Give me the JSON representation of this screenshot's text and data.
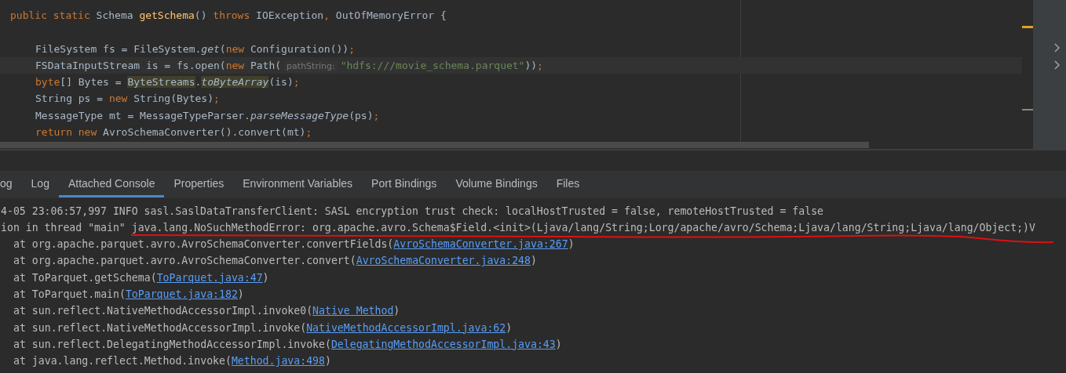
{
  "editor": {
    "lines": [
      {
        "current": false,
        "indented": false,
        "tokens": [
          {
            "kind": "keyword",
            "text": "public static"
          },
          {
            "kind": "plain",
            "text": " Schema "
          },
          {
            "kind": "declaration",
            "text": "getSchema"
          },
          {
            "kind": "plain",
            "text": "() "
          },
          {
            "kind": "keyword",
            "text": "throws"
          },
          {
            "kind": "plain",
            "text": " IOException"
          },
          {
            "kind": "keyword",
            "text": ","
          },
          {
            "kind": "plain",
            "text": " OutOfMemoryError {"
          }
        ]
      },
      {
        "current": false
      },
      {
        "current": false,
        "indented": true,
        "tokens": [
          {
            "kind": "plain",
            "text": "FileSystem fs = FileSystem."
          },
          {
            "kind": "static",
            "text": "get"
          },
          {
            "kind": "plain",
            "text": "("
          },
          {
            "kind": "keyword",
            "text": "new"
          },
          {
            "kind": "plain",
            "text": " Configuration())"
          },
          {
            "kind": "keyword",
            "text": ";"
          }
        ]
      },
      {
        "current": true,
        "indented": true,
        "tokens": [
          {
            "kind": "plain",
            "text": "FSDataInputStream is = fs.open("
          },
          {
            "kind": "keyword",
            "text": "new"
          },
          {
            "kind": "plain",
            "text": " Path("
          },
          {
            "kind": "hint",
            "text": "pathString:"
          },
          {
            "kind": "string",
            "text": "\"hdfs:///movie_schema.parquet\""
          },
          {
            "kind": "plain",
            "text": "))"
          },
          {
            "kind": "keyword",
            "text": ";"
          }
        ]
      },
      {
        "current": false,
        "indented": true,
        "tokens": [
          {
            "kind": "keyword",
            "text": "byte"
          },
          {
            "kind": "plain",
            "text": "[] Bytes = "
          },
          {
            "kind": "usage",
            "text": "ByteStreams"
          },
          {
            "kind": "plain",
            "text": "."
          },
          {
            "kind": "usage_static",
            "text": "toByteArray"
          },
          {
            "kind": "plain",
            "text": "(is)"
          },
          {
            "kind": "keyword",
            "text": ";"
          }
        ]
      },
      {
        "current": false,
        "indented": true,
        "tokens": [
          {
            "kind": "plain",
            "text": "String ps = "
          },
          {
            "kind": "keyword",
            "text": "new"
          },
          {
            "kind": "plain",
            "text": " String(Bytes)"
          },
          {
            "kind": "keyword",
            "text": ";"
          }
        ]
      },
      {
        "current": false,
        "indented": true,
        "tokens": [
          {
            "kind": "plain",
            "text": "MessageType mt = MessageTypeParser."
          },
          {
            "kind": "static",
            "text": "parseMessageType"
          },
          {
            "kind": "plain",
            "text": "(ps)"
          },
          {
            "kind": "keyword",
            "text": ";"
          }
        ]
      },
      {
        "current": false,
        "indented": true,
        "tokens": [
          {
            "kind": "keyword",
            "text": "return new"
          },
          {
            "kind": "plain",
            "text": " AvroSchemaConverter().convert(mt)"
          },
          {
            "kind": "keyword",
            "text": ";"
          }
        ]
      }
    ]
  },
  "tabs": [
    {
      "label": "og",
      "selected": false
    },
    {
      "label": "Log",
      "selected": false
    },
    {
      "label": "Attached Console",
      "selected": true
    },
    {
      "label": "Properties",
      "selected": false
    },
    {
      "label": "Environment Variables",
      "selected": false
    },
    {
      "label": "Port Bindings",
      "selected": false
    },
    {
      "label": "Volume Bindings",
      "selected": false
    },
    {
      "label": "Files",
      "selected": false
    }
  ],
  "console": [
    {
      "kind": "plain",
      "text": "4-05 23:06:57,997 INFO sasl.SaslDataTransferClient: SASL encryption trust check: localHostTrusted = false, remoteHostTrusted = false"
    },
    {
      "kind": "plain",
      "text": "ion in thread \"main\" java.lang.NoSuchMethodError: org.apache.avro.Schema$Field.<init>(Ljava/lang/String;Lorg/apache/avro/Schema;Ljava/lang/String;Ljava/lang/Object;)V"
    },
    {
      "kind": "frame",
      "text": "at org.apache.parquet.avro.AvroSchemaConverter.convertFields(",
      "link": "AvroSchemaConverter.java:267",
      "suffix": ")"
    },
    {
      "kind": "frame",
      "text": "at org.apache.parquet.avro.AvroSchemaConverter.convert(",
      "link": "AvroSchemaConverter.java:248",
      "suffix": ")"
    },
    {
      "kind": "frame",
      "text": "at ToParquet.getSchema(",
      "link": "ToParquet.java:47",
      "suffix": ")"
    },
    {
      "kind": "frame",
      "text": "at ToParquet.main(",
      "link": "ToParquet.java:182",
      "suffix": ")"
    },
    {
      "kind": "frame",
      "text": "at sun.reflect.NativeMethodAccessorImpl.invoke0(",
      "link": "Native Method",
      "suffix": ")"
    },
    {
      "kind": "frame",
      "text": "at sun.reflect.NativeMethodAccessorImpl.invoke(",
      "link": "NativeMethodAccessorImpl.java:62",
      "suffix": ")"
    },
    {
      "kind": "frame",
      "text": "at sun.reflect.DelegatingMethodAccessorImpl.invoke(",
      "link": "DelegatingMethodAccessorImpl.java:43",
      "suffix": ")"
    },
    {
      "kind": "frame",
      "text": "at java.lang.reflect.Method.invoke(",
      "link": "Method.java:498",
      "suffix": ")"
    }
  ]
}
